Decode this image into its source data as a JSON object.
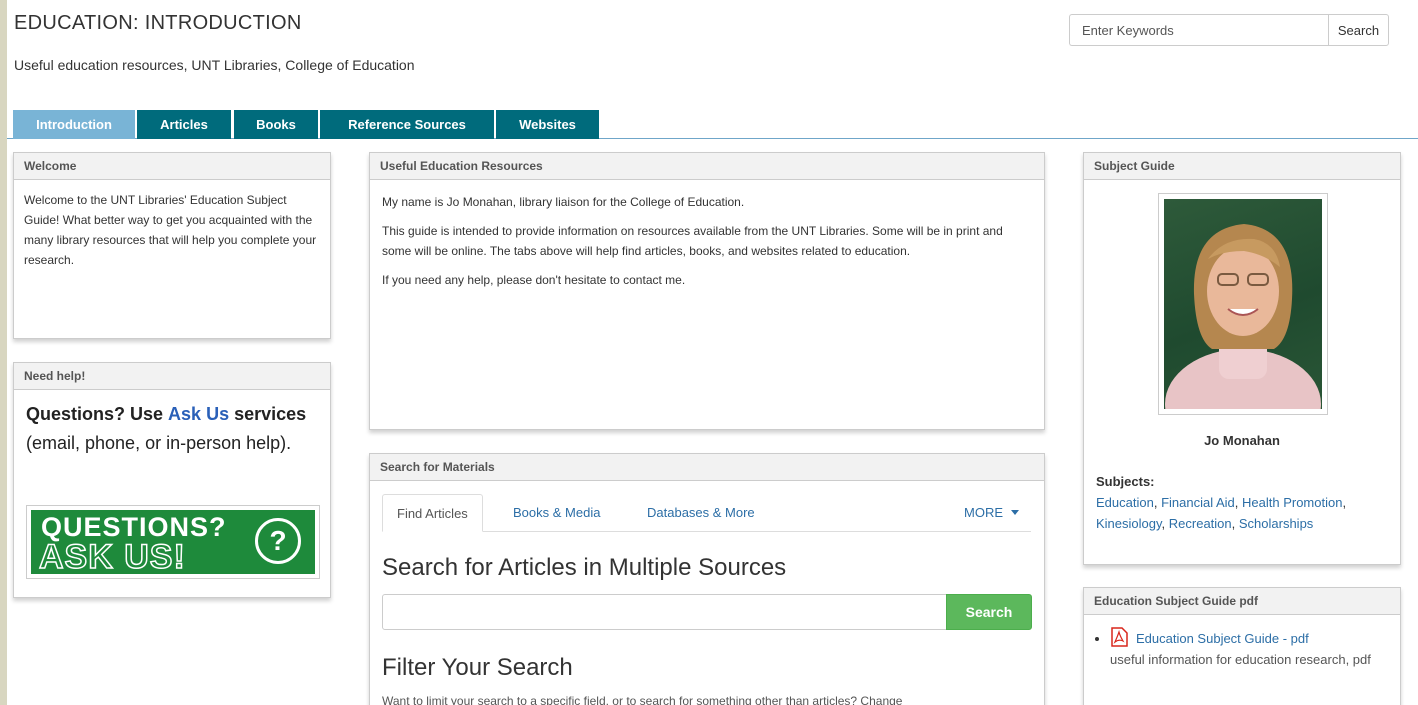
{
  "header": {
    "title": "EDUCATION: INTRODUCTION",
    "description": "Useful education resources, UNT Libraries, College of Education",
    "search_placeholder": "Enter Keywords",
    "search_button": "Search"
  },
  "tabs": [
    {
      "label": "Introduction",
      "active": true
    },
    {
      "label": "Articles"
    },
    {
      "label": "Books"
    },
    {
      "label": "Reference Sources"
    },
    {
      "label": "Websites"
    }
  ],
  "welcome": {
    "heading": "Welcome",
    "body": "Welcome to the UNT Libraries' Education Subject Guide! What better way to get you acquainted with the many library resources that will help you complete your research."
  },
  "need_help": {
    "heading": "Need help!",
    "questions": "Questions? Use",
    "ask_us_link": "Ask Us",
    "services": "services",
    "rest": "(email, phone, or in-person help).",
    "banner_line1": "QUESTIONS?",
    "banner_line2": "ASK US!",
    "banner_symbol": "?"
  },
  "resources": {
    "heading": "Useful Education Resources",
    "p1": "My name is Jo Monahan, library liaison for the College of Education.",
    "p2": "This guide is intended to provide information on resources available from the UNT Libraries. Some will be in print and some will be online. The tabs above will help find articles, books, and websites related to education.",
    "p3": "If you need any help, please don't hesitate to contact me."
  },
  "materials": {
    "heading": "Search for Materials",
    "tabs": [
      {
        "label": "Find Articles",
        "active": true
      },
      {
        "label": "Books & Media"
      },
      {
        "label": "Databases & More"
      }
    ],
    "more_label": "MORE",
    "search_heading": "Search for Articles in Multiple Sources",
    "search_button": "Search",
    "filter_heading": "Filter Your Search",
    "filter_text": "Want to limit your search to a specific field, or to search for something other than articles? Change"
  },
  "subject_guide": {
    "heading": "Subject Guide",
    "name": "Jo Monahan",
    "subjects_label": "Subjects:",
    "subjects": [
      "Education",
      "Financial Aid",
      "Health Promotion",
      "Kinesiology",
      "Recreation",
      "Scholarships"
    ]
  },
  "pdf_guide": {
    "heading": "Education Subject Guide pdf",
    "link": "Education Subject Guide - pdf",
    "desc": "useful information for education research, pdf"
  },
  "colors": {
    "tab": "#006b7c",
    "tab_active": "#79b4d6",
    "link": "#2c6ea6",
    "green_button": "#5cb85c"
  }
}
